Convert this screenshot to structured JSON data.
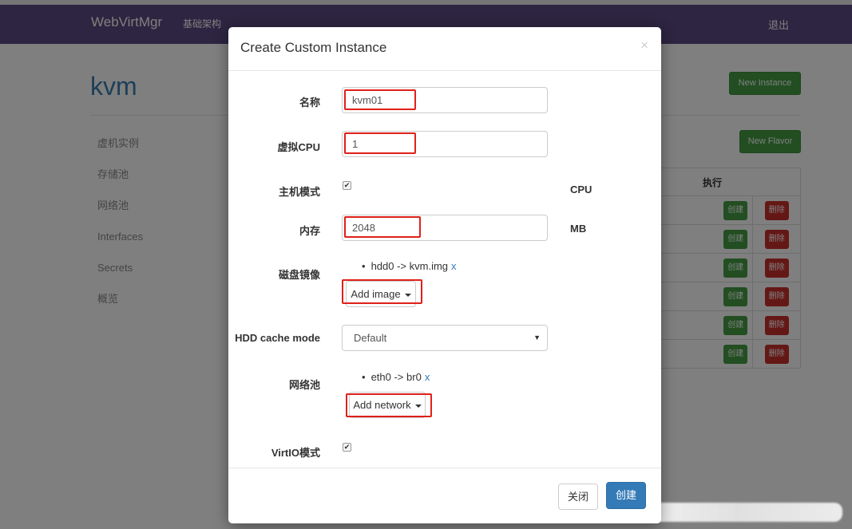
{
  "navbar": {
    "brand": "WebVirtMgr",
    "link": "基础架构",
    "logout": "退出"
  },
  "page": {
    "title": "kvm"
  },
  "sidebar": {
    "items": [
      "虚机实例",
      "存储池",
      "网络池",
      "Interfaces",
      "Secrets",
      "概览"
    ]
  },
  "buttons": {
    "new_instance": "New Instance",
    "new_flavor": "New Flavor"
  },
  "bg_table": {
    "header": "执行",
    "rows": [
      {
        "create": "创建",
        "delete": "删除"
      },
      {
        "create": "创建",
        "delete": "删除"
      },
      {
        "create": "创建",
        "delete": "删除"
      },
      {
        "create": "创建",
        "delete": "删除"
      },
      {
        "create": "创建",
        "delete": "删除"
      },
      {
        "create": "创建",
        "delete": "删除"
      }
    ]
  },
  "modal": {
    "title": "Create Custom Instance",
    "close_icon": "×",
    "fields": {
      "name_label": "名称",
      "name_value": "kvm01",
      "vcpu_label": "虚拟CPU",
      "vcpu_value": "1",
      "host_mode_label": "主机模式",
      "host_mode_checked": true,
      "cpu_unit": "CPU",
      "memory_label": "内存",
      "memory_value": "2048",
      "memory_unit": "MB",
      "disk_label": "磁盘镜像",
      "disk_item": "hdd0 -> kvm.img",
      "remove_x": "x",
      "add_image": "Add image",
      "cache_label": "HDD cache mode",
      "cache_value": "Default",
      "network_label": "网络池",
      "network_item": "eth0 -> br0",
      "add_network": "Add network",
      "virtio_label": "VirtIO模式",
      "virtio_checked": true
    },
    "footer": {
      "close": "关闭",
      "create": "创建"
    }
  },
  "colors": {
    "navbar": "#5b4a82",
    "primary": "#337ab7",
    "success": "#449d44",
    "danger": "#c9302c",
    "highlight": "#e0201a"
  }
}
